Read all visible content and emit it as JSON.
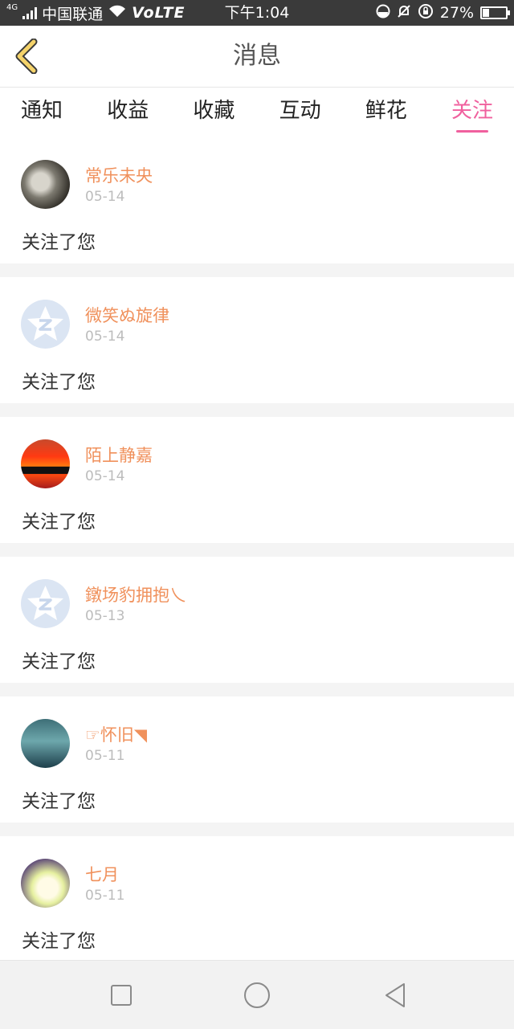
{
  "status_bar": {
    "network_type": "4G",
    "carrier": "中国联通",
    "volte": "VoLTE",
    "time": "下午1:04",
    "battery": "27%",
    "battery_level": 0.27
  },
  "header": {
    "title": "消息"
  },
  "tabs": [
    {
      "label": "通知",
      "active": false
    },
    {
      "label": "收益",
      "active": false
    },
    {
      "label": "收藏",
      "active": false
    },
    {
      "label": "互动",
      "active": false
    },
    {
      "label": "鲜花",
      "active": false
    },
    {
      "label": "关注",
      "active": true
    }
  ],
  "messages": [
    {
      "username": "常乐未央",
      "date": "05-14",
      "action": "关注了您"
    },
    {
      "username": "微笑ぬ旋律",
      "date": "05-14",
      "action": "关注了您"
    },
    {
      "username": "陌上静嘉",
      "date": "05-14",
      "action": "关注了您"
    },
    {
      "username": "鐓场豹拥抱乀",
      "date": "05-13",
      "action": "关注了您"
    },
    {
      "username": "☞怀旧◥",
      "date": "05-11",
      "action": "关注了您"
    },
    {
      "username": "七月",
      "date": "05-11",
      "action": "关注了您"
    }
  ],
  "colors": {
    "accent": "#f0609e",
    "username": "#f0915c",
    "back_icon": "#f5d36a"
  }
}
